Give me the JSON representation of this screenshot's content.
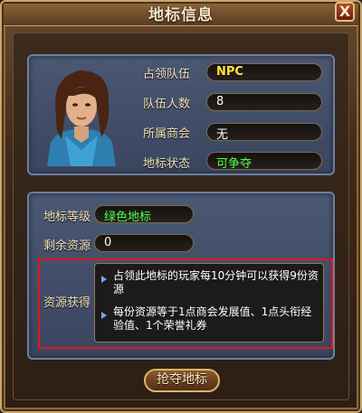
{
  "window": {
    "title": "地标信息",
    "close_glyph": "X"
  },
  "team_info": {
    "occupy_team_label": "占领队伍",
    "occupy_team_value": "NPC",
    "team_size_label": "队伍人数",
    "team_size_value": "8",
    "guild_label": "所属商会",
    "guild_value": "无",
    "status_label": "地标状态",
    "status_value": "可争夺"
  },
  "landmark": {
    "level_label": "地标等级",
    "level_value": "绿色地标",
    "remaining_label": "剩余资源",
    "remaining_value": "0",
    "gain_label": "资源获得",
    "gain_lines": [
      "占领此地标的玩家每10分钟可以获得9份资源",
      "每份资源等于1点商会发展值、1点头衔经验值、1个荣誉礼券"
    ]
  },
  "actions": {
    "seize_button": "抢夺地标"
  },
  "colors": {
    "accent_yellow": "#ffe23a",
    "status_green": "#4cff4c",
    "highlight_red": "#e01818"
  }
}
